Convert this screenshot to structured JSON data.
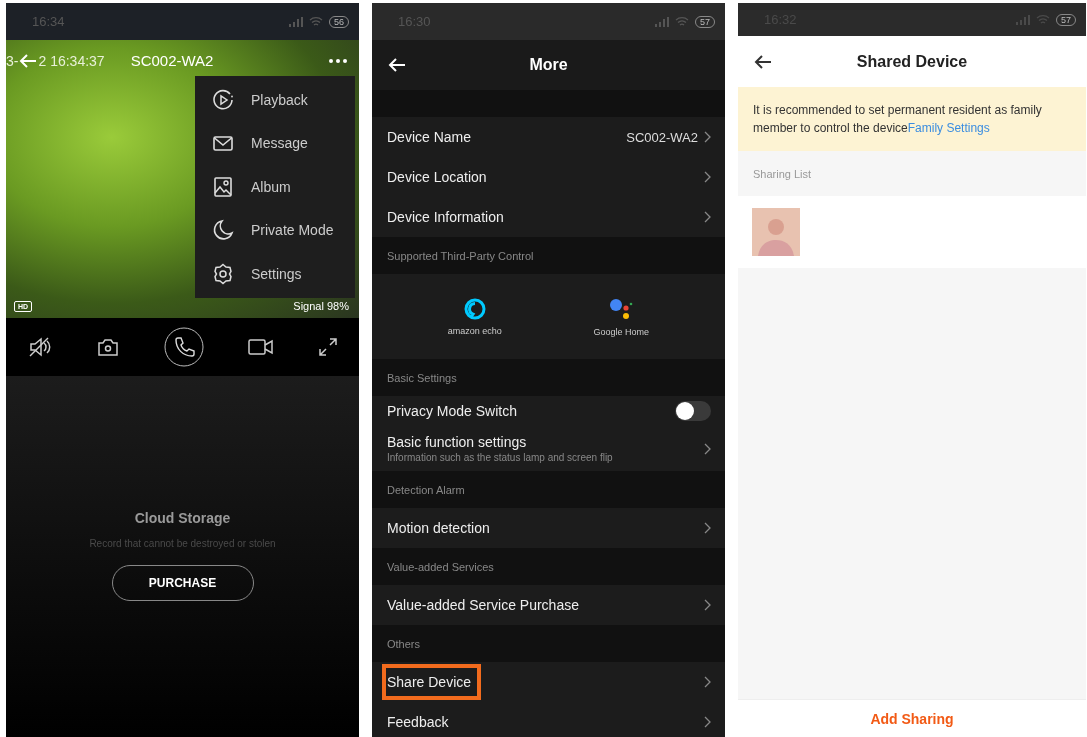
{
  "live_view": {
    "status_bar": {
      "time": "16:34",
      "battery": "56"
    },
    "timestamp_left": "3-",
    "timestamp_right": "2 16:34:37",
    "title": "SC002-WA2",
    "quality": "HD",
    "signal": "Signal 98%",
    "menu": [
      {
        "kind": "playback",
        "label": "Playback"
      },
      {
        "kind": "message",
        "label": "Message"
      },
      {
        "kind": "album",
        "label": "Album"
      },
      {
        "kind": "moon",
        "label": "Private Mode"
      },
      {
        "kind": "settings",
        "label": "Settings"
      }
    ],
    "controls": [
      {
        "kind": "mute"
      },
      {
        "kind": "camera"
      },
      {
        "kind": "call"
      },
      {
        "kind": "record"
      },
      {
        "kind": "fullscreen"
      }
    ],
    "cloud": {
      "title": "Cloud Storage",
      "subtitle": "Record that cannot be destroyed or stolen",
      "button": "PURCHASE"
    }
  },
  "more": {
    "status_bar": {
      "time": "16:30",
      "battery": "57"
    },
    "title": "More",
    "sections": [
      {
        "items": [
          {
            "kind": "link",
            "label": "Device Name",
            "value": "SC002-WA2",
            "highlighted": false
          },
          {
            "kind": "link",
            "label": "Device Location",
            "highlighted": false
          },
          {
            "kind": "link",
            "label": "Device Information",
            "highlighted": false
          }
        ]
      },
      {
        "header": "Supported Third-Party Control",
        "items": [
          {
            "kind": "integrations",
            "logos": [
              {
                "kind": "alexa",
                "caption": "amazon echo"
              },
              {
                "kind": "google",
                "caption": "Google Home"
              }
            ]
          }
        ]
      },
      {
        "header": "Basic Settings",
        "items": [
          {
            "kind": "toggle",
            "label": "Privacy Mode Switch",
            "on": false
          },
          {
            "kind": "link",
            "label": "Basic function settings",
            "subtitle": "Information such as the status lamp and screen flip",
            "highlighted": false
          }
        ]
      },
      {
        "header": "Detection Alarm",
        "items": [
          {
            "kind": "link",
            "label": "Motion detection",
            "highlighted": false
          }
        ]
      },
      {
        "header": "Value-added Services",
        "items": [
          {
            "kind": "link",
            "label": "Value-added Service Purchase",
            "highlighted": false
          }
        ]
      },
      {
        "header": "Others",
        "items": [
          {
            "kind": "link",
            "label": "Share Device",
            "highlighted": true
          },
          {
            "kind": "link",
            "label": "Feedback",
            "highlighted": false
          }
        ]
      }
    ]
  },
  "shared": {
    "status_bar": {
      "time": "16:32",
      "battery": "57"
    },
    "title": "Shared Device",
    "notice": {
      "text": "It is recommended to set permanent resident as family member to control the device",
      "link": "Family Settings"
    },
    "list_header": "Sharing List",
    "button": "Add Sharing"
  }
}
